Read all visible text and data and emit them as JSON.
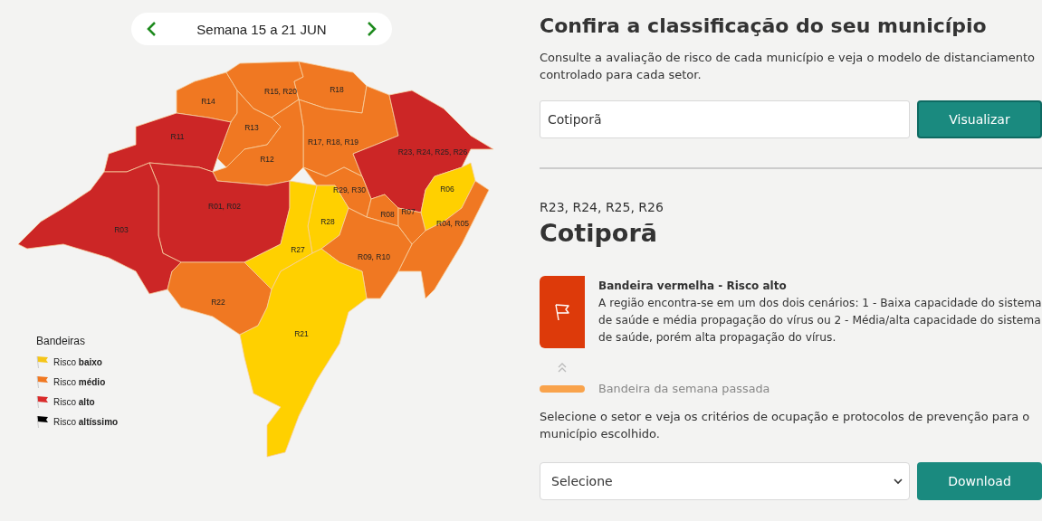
{
  "week_selector": {
    "label": "Semana 15 a 21 JUN"
  },
  "map": {
    "regions": [
      {
        "label": "R14",
        "color": "#f07822"
      },
      {
        "label": "R15, R20",
        "color": "#f07822"
      },
      {
        "label": "R18",
        "color": "#f07822"
      },
      {
        "label": "R13",
        "color": "#f07822"
      },
      {
        "label": "R11",
        "color": "#cc2626"
      },
      {
        "label": "R17, R18, R19",
        "color": "#f07822"
      },
      {
        "label": "R12",
        "color": "#f07822"
      },
      {
        "label": "R23, R24, R25, R26",
        "color": "#cc2626"
      },
      {
        "label": "R06",
        "color": "#ffd000"
      },
      {
        "label": "R29, R30",
        "color": "#f07822"
      },
      {
        "label": "R01, R02",
        "color": "#cc2626"
      },
      {
        "label": "R28",
        "color": "#ffd000"
      },
      {
        "label": "R08",
        "color": "#f07822"
      },
      {
        "label": "R07",
        "color": "#f07822"
      },
      {
        "label": "R04, R05",
        "color": "#f07822"
      },
      {
        "label": "R03",
        "color": "#cc2626"
      },
      {
        "label": "R27",
        "color": "#ffd000"
      },
      {
        "label": "R09, R10",
        "color": "#f07822"
      },
      {
        "label": "R22",
        "color": "#f07822"
      },
      {
        "label": "R21",
        "color": "#ffd000"
      }
    ]
  },
  "legend": {
    "title": "Bandeiras",
    "items": [
      {
        "label": "Risco **baixo**",
        "color": "#f5c518"
      },
      {
        "label": "Risco **médio**",
        "color": "#f07822"
      },
      {
        "label": "Risco **alto**",
        "color": "#d92b2b"
      },
      {
        "label": "Risco **altíssimo**",
        "color": "#000000"
      }
    ]
  },
  "title": "Confira a classificação do seu município",
  "description": "Consulte a avaliação de risco de cada município e veja o modelo de distanciamento controlado para cada setor.",
  "search": {
    "value": "Cotiporã",
    "button": "Visualizar"
  },
  "result": {
    "regions": "R23, R24, R25, R26",
    "municipality": "Cotiporã",
    "flag": {
      "title": "Bandeira vermelha - Risco alto",
      "description": "A região encontra-se em um dos dois cenários: 1 - Baixa capacidade do sistema de saúde e média propagação do vírus ou 2 - Média/alta capacidade do sistema de saúde, porém alta propagação do vírus.",
      "color": "#dd3a0a"
    },
    "previous_week": {
      "label": "Bandeira da semana passada",
      "color": "#f9a34c"
    }
  },
  "sector_text": "Selecione o setor e veja os critérios de ocupação e protocolos de prevenção para o município escolhido.",
  "sector_select": {
    "value": "Selecione",
    "button": "Download"
  }
}
